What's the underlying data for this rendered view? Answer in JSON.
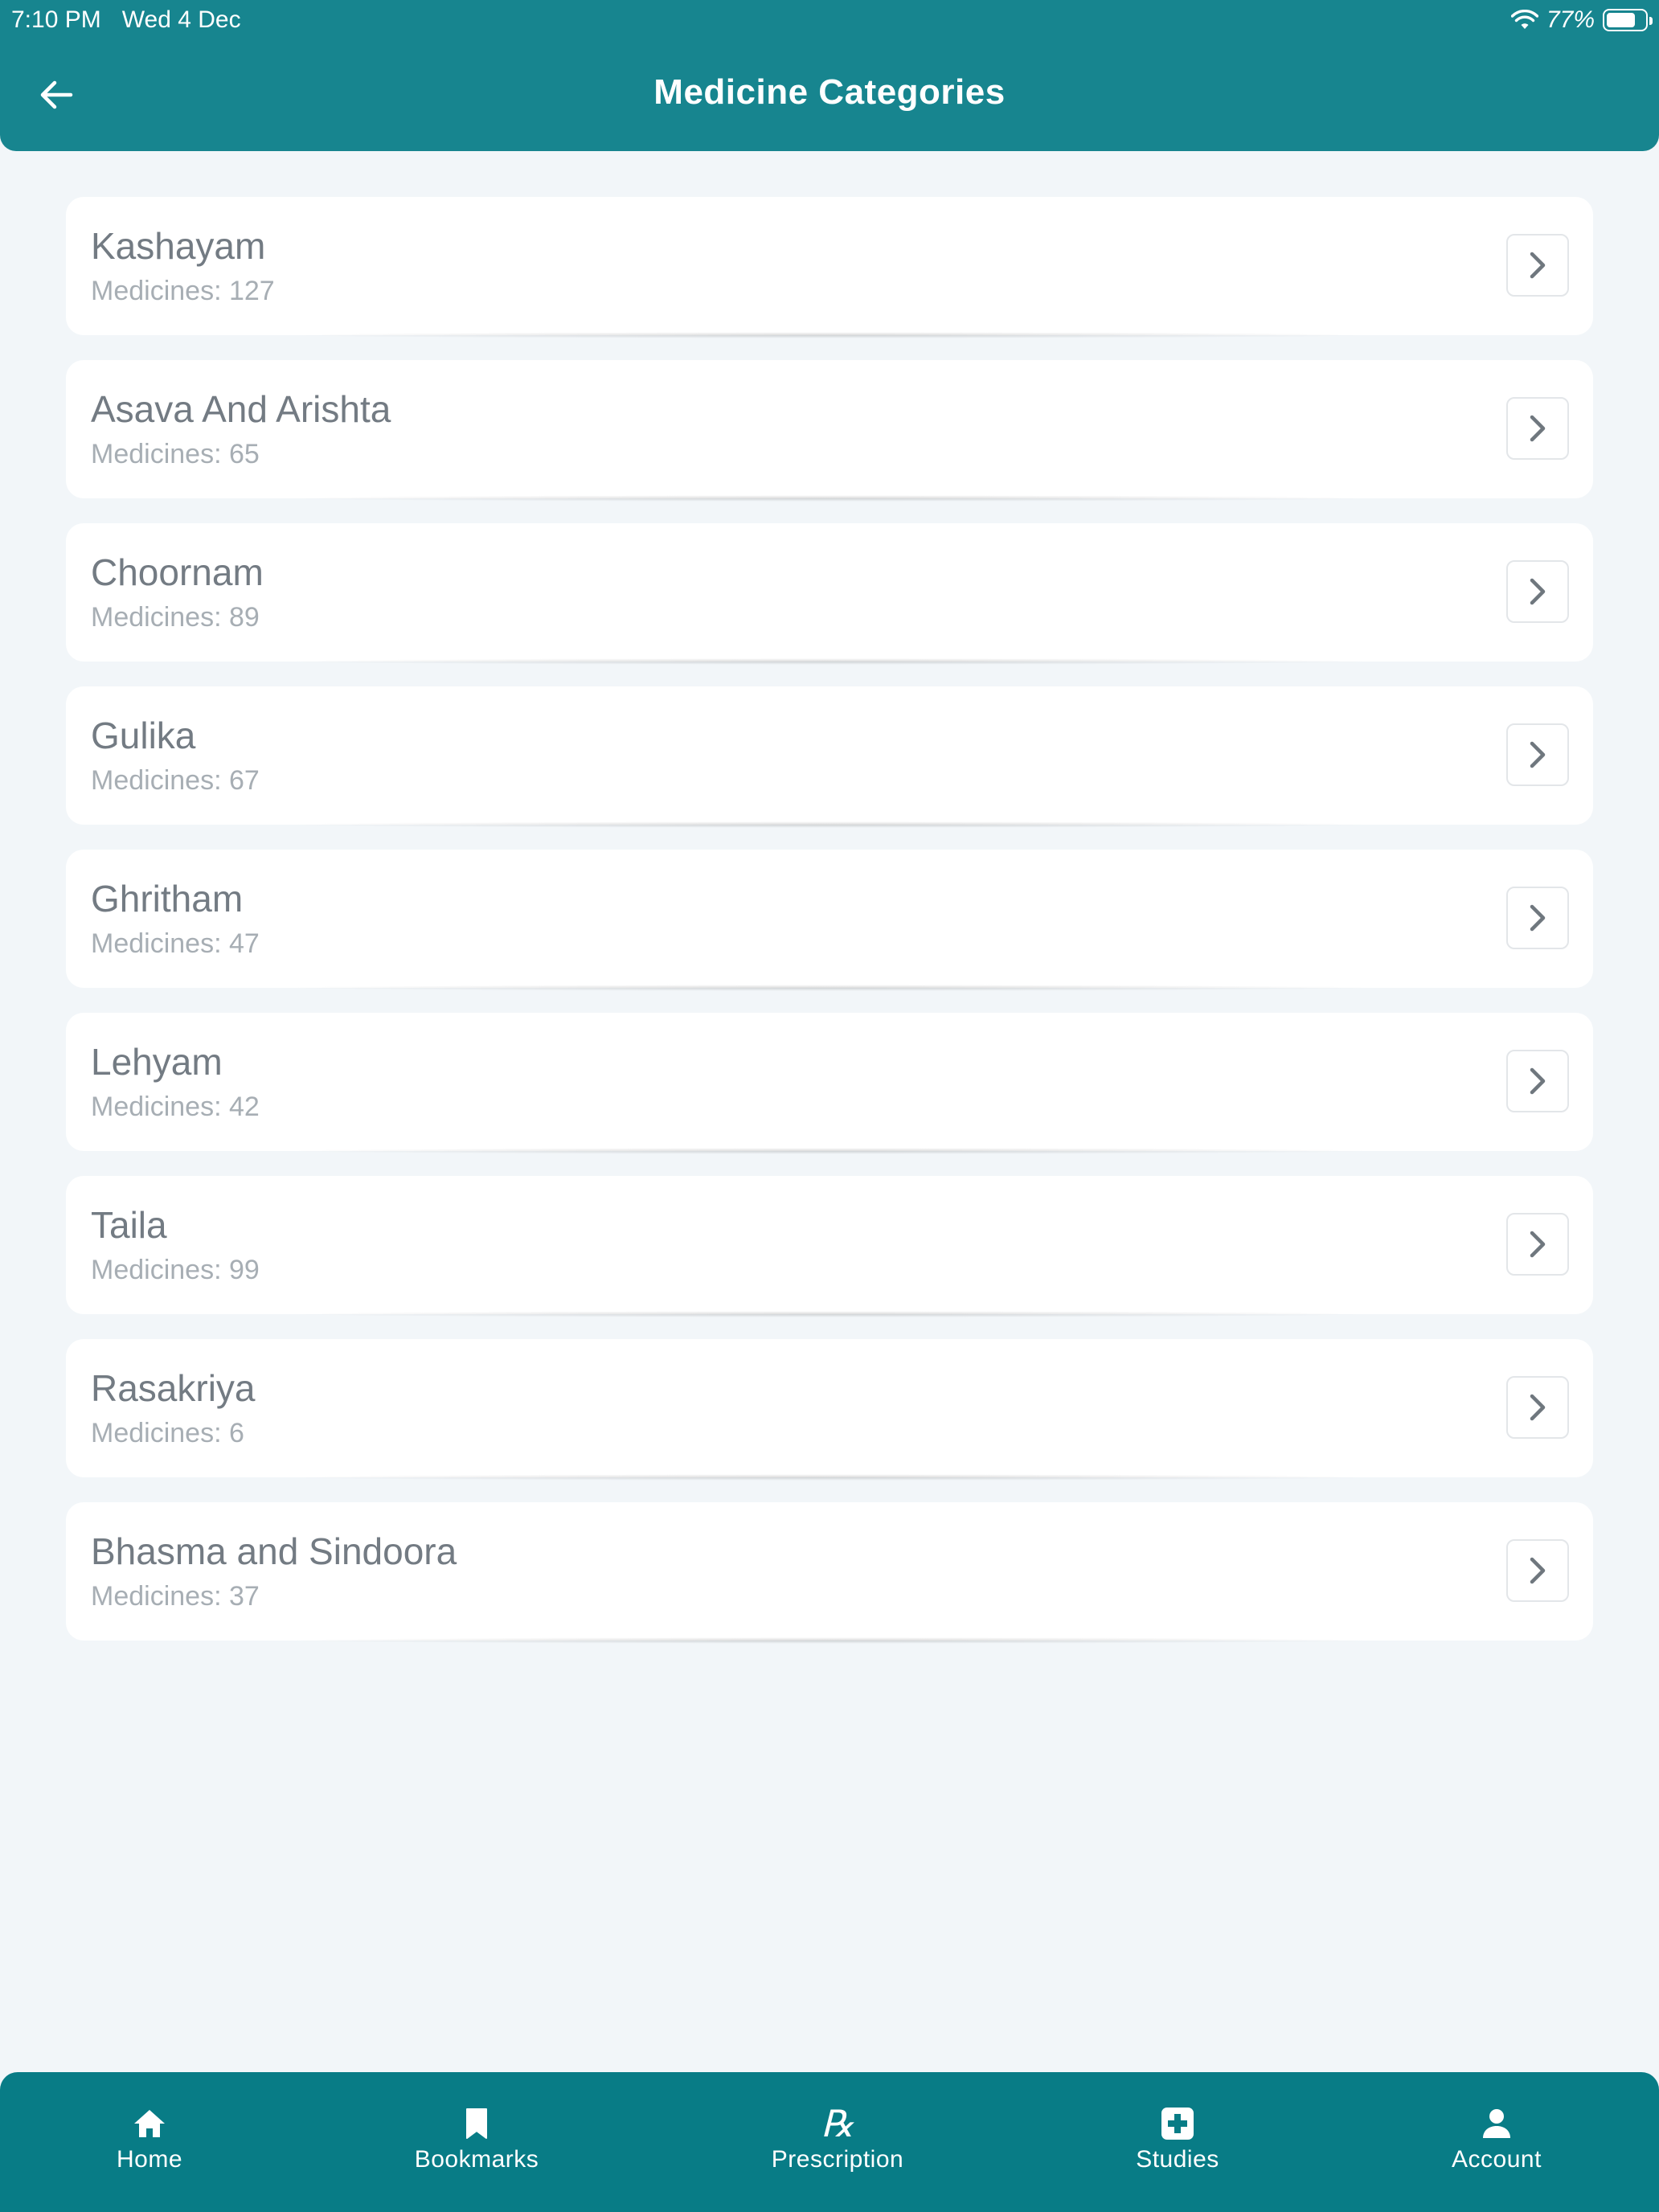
{
  "status_bar": {
    "time": "7:10 PM",
    "date": "Wed 4 Dec",
    "battery": "77%",
    "battery_level": 0.77
  },
  "header": {
    "title": "Medicine Categories",
    "back_icon": "arrow-left-icon"
  },
  "categories": [
    {
      "name": "Kashayam",
      "count": "Medicines: 127"
    },
    {
      "name": "Asava And Arishta",
      "count": "Medicines: 65"
    },
    {
      "name": "Choornam",
      "count": "Medicines: 89"
    },
    {
      "name": "Gulika",
      "count": "Medicines: 67"
    },
    {
      "name": "Ghritham",
      "count": "Medicines: 47"
    },
    {
      "name": "Lehyam",
      "count": "Medicines: 42"
    },
    {
      "name": "Taila",
      "count": "Medicines: 99"
    },
    {
      "name": "Rasakriya",
      "count": "Medicines: 6"
    },
    {
      "name": "Bhasma and Sindoora",
      "count": "Medicines: 37"
    }
  ],
  "bottom_nav": [
    {
      "label": "Home",
      "icon": "home-icon"
    },
    {
      "label": "Bookmarks",
      "icon": "bookmark-icon"
    },
    {
      "label": "Prescription",
      "icon": "rx-icon",
      "glyph": "℞"
    },
    {
      "label": "Studies",
      "icon": "medical-cross-icon"
    },
    {
      "label": "Account",
      "icon": "user-icon"
    }
  ],
  "colors": {
    "header": "#17858f",
    "nav": "#087c86",
    "background": "#f2f6f9"
  }
}
